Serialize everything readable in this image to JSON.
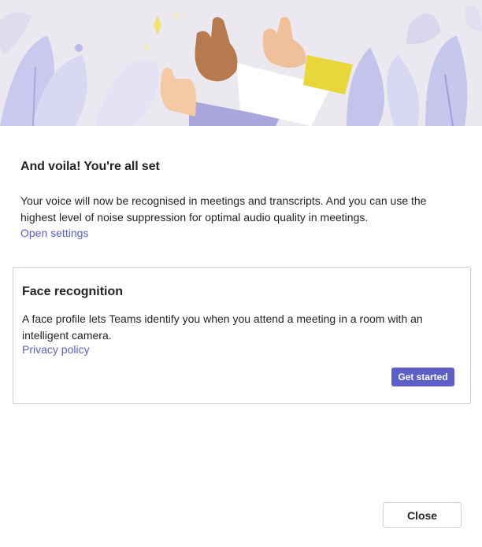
{
  "hero": {
    "image": "thumbs-up-illustration"
  },
  "main": {
    "title": "And voila! You're all set",
    "description": "Your voice will now be recognised in meetings and transcripts. And you can use the highest level of noise suppression for optimal audio quality in meetings.",
    "open_settings_link": "Open settings"
  },
  "face_card": {
    "title": "Face recognition",
    "description": "A face profile lets Teams identify you when you attend a meeting in a room with an intelligent camera.",
    "privacy_link": "Privacy policy",
    "get_started_label": "Get started"
  },
  "footer": {
    "close_label": "Close"
  },
  "colors": {
    "accent": "#5b5fc7",
    "border": "#d1d1d1",
    "text": "#242424",
    "hero_bg": "#ebe9ef"
  }
}
